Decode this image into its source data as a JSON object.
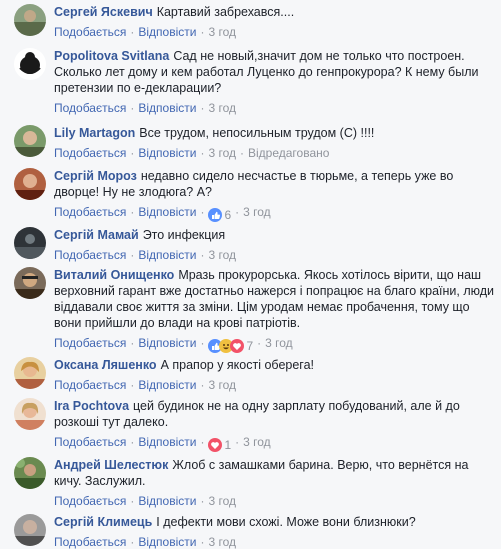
{
  "comments": [
    {
      "author": "Сергей Яскевич",
      "text": "Картавий забрехався....",
      "like": "Подобається",
      "reply": "Відповісти",
      "time": "3 год",
      "avatar_color": "#7a8a6a",
      "reaction": null,
      "edited": ""
    },
    {
      "author": "Popolitova Svitlana",
      "text": "Сад не новый,значит дом не только что построен. Сколько лет дому и кем работал Луценко до генпрокурора? К нему были претензии по е-декларации?",
      "like": "Подобається",
      "reply": "Відповісти",
      "time": "3 год",
      "avatar_color": "#ffffff",
      "reaction": null,
      "edited": ""
    },
    {
      "author": "Lily Martagon",
      "text": "Все трудом, непосильным трудом (С) !!!!",
      "like": "Подобається",
      "reply": "Відповісти",
      "time": "3 год",
      "avatar_color": "#6b8a5a",
      "reaction": null,
      "edited": "Відредаговано"
    },
    {
      "author": "Сергій Мороз",
      "text": "недавно сидело несчастье в тюрьме, а теперь уже во дворце! Ну не злодюга? А?",
      "like": "Подобається",
      "reply": "Відповісти",
      "time": "3 год",
      "avatar_color": "#a0522d",
      "reaction": {
        "type": "like",
        "count": "6"
      },
      "edited": ""
    },
    {
      "author": "Сергій Мамай",
      "text": "Это инфекция",
      "like": "Подобається",
      "reply": "Відповісти",
      "time": "3 год",
      "avatar_color": "#3a3f44",
      "reaction": null,
      "edited": ""
    },
    {
      "author": "Виталий Онищенко",
      "text": "Мразь прокурорська. Якось хотілось вірити, що наш верховний гарант вже достатньо нажерся і попрацює на благо країни, люди віддавали своє життя за зміни. Цім уродам немає пробачення, тому що вони прийшли до влади на крові патріотів.",
      "like": "Подобається",
      "reply": "Відповісти",
      "time": "3 год",
      "avatar_color": "#8a6a4a",
      "reaction": {
        "type": "like-haha",
        "count": "7"
      },
      "edited": ""
    },
    {
      "author": "Оксана Ляшенко",
      "text": "А прапор у якості оберега!",
      "like": "Подобається",
      "reply": "Відповісти",
      "time": "3 год",
      "avatar_color": "#c8a070",
      "reaction": null,
      "edited": ""
    },
    {
      "author": "Ira Pochtova",
      "text": "цей будинок не на одну зарплату побудований, але й до розкоші тут далеко.",
      "like": "Подобається",
      "reply": "Відповісти",
      "time": "3 год",
      "avatar_color": "#c89070",
      "reaction": {
        "type": "love",
        "count": "1"
      },
      "edited": ""
    },
    {
      "author": "Андрей Шелестюк",
      "text": "Жлоб с замашками барина. Верю, что вернётся на кичу. Заслужил.",
      "like": "Подобається",
      "reply": "Відповісти",
      "time": "3 год",
      "avatar_color": "#5a7a4a",
      "reaction": null,
      "edited": ""
    },
    {
      "author": "Сергій Климець",
      "text": "І дефекти мови схожі. Може вони близнюки?",
      "like": "Подобається",
      "reply": "Відповісти",
      "time": "3 год",
      "avatar_color": "#8a8a8a",
      "reaction": null,
      "edited": ""
    }
  ]
}
